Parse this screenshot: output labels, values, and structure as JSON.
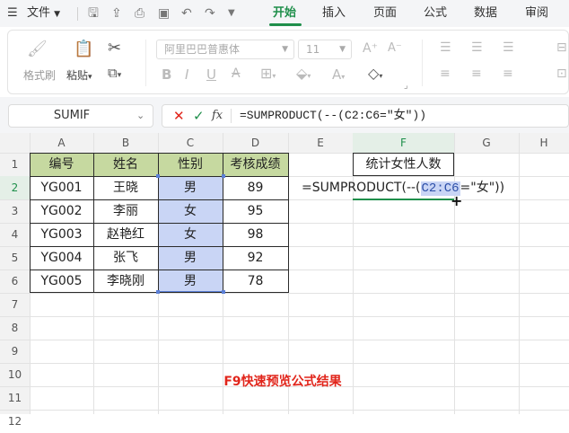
{
  "menu": {
    "file_label": "文件",
    "tabs": [
      "开始",
      "插入",
      "页面",
      "公式",
      "数据",
      "审阅"
    ],
    "active_tab": "开始"
  },
  "ribbon": {
    "format_painter": "格式刷",
    "paste": "粘贴",
    "font_name": "阿里巴巴普惠体",
    "font_size": "11"
  },
  "formula_bar": {
    "name_box": "SUMIF",
    "fx": "fx",
    "formula": "=SUMPRODUCT(--(C2:C6=\"女\"))"
  },
  "sheet": {
    "columns": [
      "A",
      "B",
      "C",
      "D",
      "E",
      "F",
      "G",
      "H"
    ],
    "rows": [
      "1",
      "2",
      "3",
      "4",
      "5",
      "6",
      "7",
      "8",
      "9",
      "10",
      "11",
      "12"
    ],
    "headers": [
      "编号",
      "姓名",
      "性别",
      "考核成绩"
    ],
    "data": [
      [
        "YG001",
        "王晓",
        "男",
        "89"
      ],
      [
        "YG002",
        "李丽",
        "女",
        "95"
      ],
      [
        "YG003",
        "赵艳红",
        "女",
        "98"
      ],
      [
        "YG004",
        "张飞",
        "男",
        "92"
      ],
      [
        "YG005",
        "李晓刚",
        "男",
        "78"
      ]
    ],
    "f1_label": "统计女性人数",
    "edit_formula_prefix": "=SUMPRODUCT(--(",
    "edit_formula_ref": "C2:C6",
    "edit_formula_suffix": "=\"女\"))",
    "caption": "F9快速预览公式结果"
  },
  "colors": {
    "header_fill": "#c6d9a0",
    "selection_fill": "#c9d5f5",
    "selection_border": "#5b7fd6",
    "accent_green": "#1f8f4b",
    "caption_red": "#e1251b"
  }
}
